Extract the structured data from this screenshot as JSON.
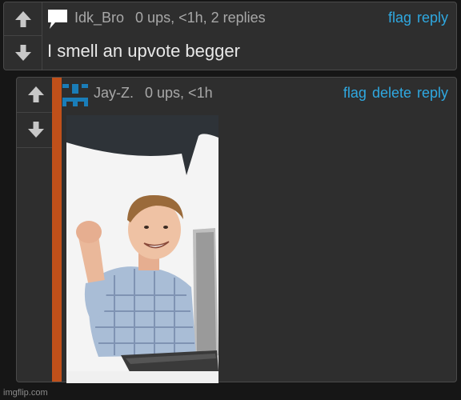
{
  "comments": [
    {
      "username": "Idk_Bro",
      "meta": "0 ups, <1h, 2 replies",
      "text": "I smell an upvote begger",
      "actions": [
        "flag",
        "reply"
      ]
    },
    {
      "username": "Jay-Z.",
      "meta": "0 ups, <1h",
      "actions": [
        "flag",
        "delete",
        "reply"
      ],
      "image": "kid-at-laptop-fist-pump-meme-with-speech-bubble"
    }
  ],
  "icons": {
    "upvote": "up-arrow-icon",
    "downvote": "down-arrow-icon",
    "speech": "speech-bubble-icon",
    "avatar": "pixel-avatar-icon"
  },
  "colors": {
    "link": "#2fa8e0",
    "accent_bar": "#c0501a",
    "avatar": "#1a7db8"
  },
  "watermark": "imgflip.com"
}
